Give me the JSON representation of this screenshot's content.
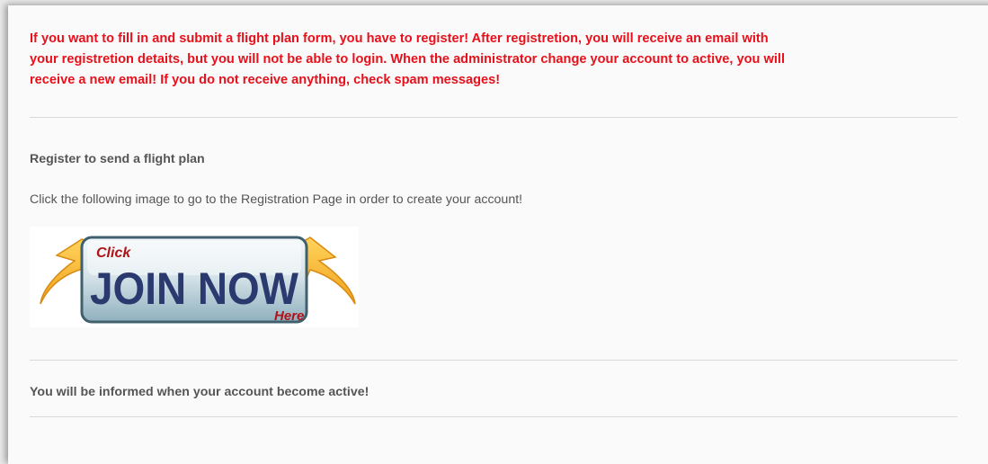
{
  "notice": {
    "line1": "If you want to fill in and submit a flight plan form, you have to register! After registretion, you will receive an email with",
    "line2": "your registretion detaits, but you will not be able to login. When the administrator change your account to active, you will",
    "line3": "receive a new email! If you do not receive anything, check spam messages!"
  },
  "register": {
    "heading": "Register to send a flight plan",
    "instruction": "Click the following image to go to the Registration Page in order to create your account!"
  },
  "join_button": {
    "click_text": "Click",
    "main_text": "JOIN NOW",
    "here_text": "Here"
  },
  "footer": {
    "text": "You will be informed when your account become active!"
  },
  "colors": {
    "notice_red": "#e8101a",
    "body_text": "#555555",
    "join_text_navy": "#2a3a6e",
    "join_text_red": "#b01218",
    "arrow_orange": "#f5a623"
  }
}
